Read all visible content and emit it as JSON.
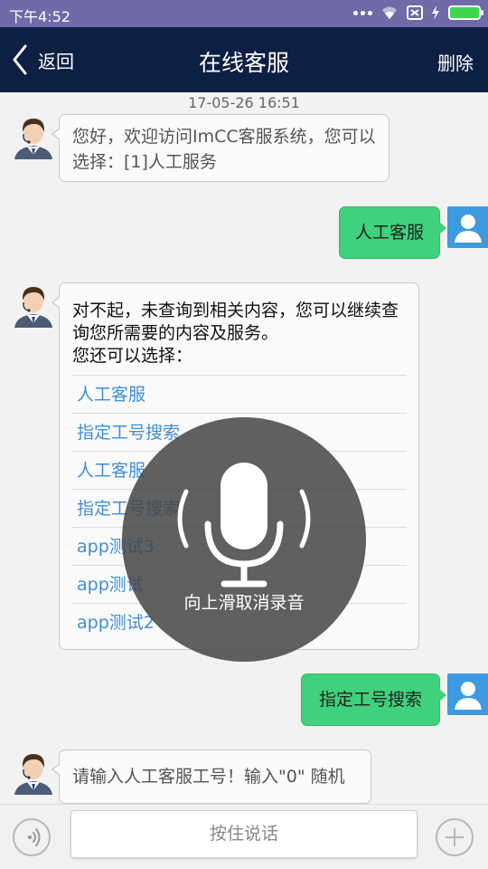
{
  "status_bar": {
    "time": "下午4:52",
    "icons": [
      "more-dots-icon",
      "wifi-icon",
      "sim-icon",
      "charging-icon",
      "battery-icon"
    ],
    "battery_color": "#3fd64d"
  },
  "header": {
    "back_label": "返回",
    "title": "在线客服",
    "delete_label": "删除"
  },
  "chat": {
    "timestamp": "17-05-26 16:51",
    "messages": [
      {
        "from": "agent",
        "text": "您好，欢迎访问ImCC客服系统，您可以选择：[1]人工服务"
      },
      {
        "from": "user",
        "text": "人工客服"
      },
      {
        "from": "agent",
        "text": "对不起，未查询到相关内容，您可以继续查询您所需要的内容及服务。\n您还可以选择：",
        "options": [
          "人工客服",
          "指定工号搜索",
          "人工客服",
          "指定工号搜索",
          "app测试3",
          "app测试",
          "app测试2"
        ]
      },
      {
        "from": "user",
        "text": "指定工号搜索"
      },
      {
        "from": "agent",
        "text": "请输入人工客服工号！输入\"0\" 随机"
      }
    ]
  },
  "recording_overlay": {
    "hint": "向上滑取消录音",
    "icon": "microphone-icon"
  },
  "input_bar": {
    "hold_to_talk": "按住说话",
    "left_icon": "voice-icon",
    "right_icon": "plus-icon"
  },
  "colors": {
    "nav_bg": "#0e1f44",
    "status_bg": "#6f6aa8",
    "user_bubble": "#3fd17c",
    "link": "#3f8fd6",
    "user_avatar": "#3e9ae0"
  }
}
